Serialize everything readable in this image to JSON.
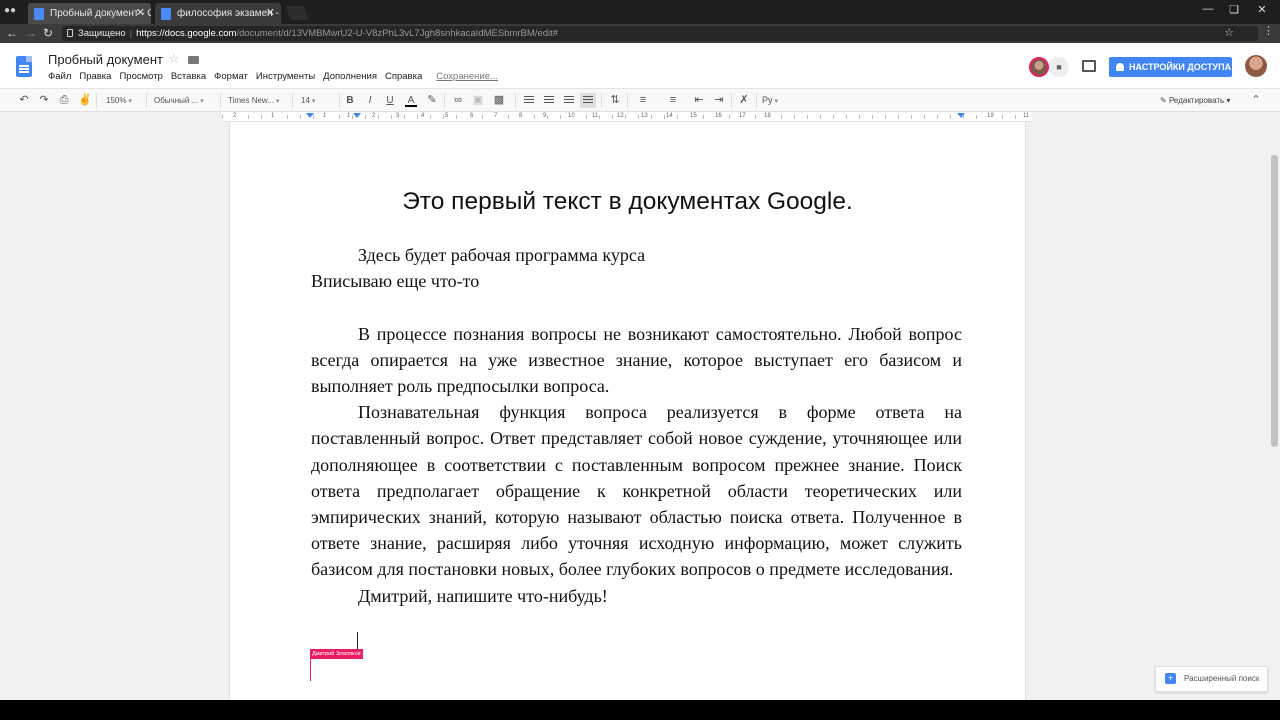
{
  "browser": {
    "tabs": [
      {
        "title": "Пробный документ - Gc",
        "active": true
      },
      {
        "title": "философия экзамен - Gc",
        "active": false
      }
    ],
    "address": {
      "secure_label": "Защищено",
      "url_host": "https://docs.google.com",
      "url_path": "/document/d/13VMBMwrU2-U-V8zPhL3vL7Jgh8snhkacaIdMESbmrBM/edit#"
    }
  },
  "docs": {
    "title": "Пробный документ",
    "menu": [
      "Файл",
      "Правка",
      "Просмотр",
      "Вставка",
      "Формат",
      "Инструменты",
      "Дополнения",
      "Справка"
    ],
    "saving_status": "Сохранение...",
    "share_label": "НАСТРОЙКИ ДОСТУПА",
    "toolbar": {
      "zoom": "150%",
      "style": "Обычный ...",
      "font": "Times New...",
      "size": "14",
      "language": "Ру",
      "mode": "Редактировать"
    },
    "ruler_labels": [
      "2",
      "1",
      "1",
      "1",
      "2",
      "3",
      "4",
      "5",
      "6",
      "7",
      "8",
      "9",
      "10",
      "11",
      "12",
      "13",
      "14",
      "15",
      "16",
      "17",
      "18",
      "19",
      "11"
    ]
  },
  "document": {
    "heading": "Это первый текст в документах Google.",
    "lines": {
      "l1": "Здесь будет рабочая программа курса",
      "l2": "Вписываю еще что-то",
      "p1": "В процессе познания вопросы не возникают самостоятельно. Любой вопрос всегда опирается на уже известное знание, которое выступает его базисом и выполняет роль предпосылки вопроса.",
      "p2": "Познавательная функция вопроса реализуется в форме ответа на поставленный вопрос. Ответ представляет собой новое суждение, уточняющее или дополняющее в соответствии с поставленным вопросом прежнее знание. Поиск ответа предполагает обращение к конкретной области теоретических или эмпирических знаний, которую называют областью поиска ответа. Полученное в ответе знание, расширяя либо уточняя исходную информацию, может служить базисом для постановки новых, более глубоких вопросов о предмете исследования.",
      "p3": "Дмитрий, напишите что-нибудь!"
    },
    "collaborator": "Дмитрий Земляков"
  },
  "explore_label": "Расширенный поиск",
  "colors": {
    "accent": "#4285f4",
    "collaborator": "#e91e63"
  }
}
